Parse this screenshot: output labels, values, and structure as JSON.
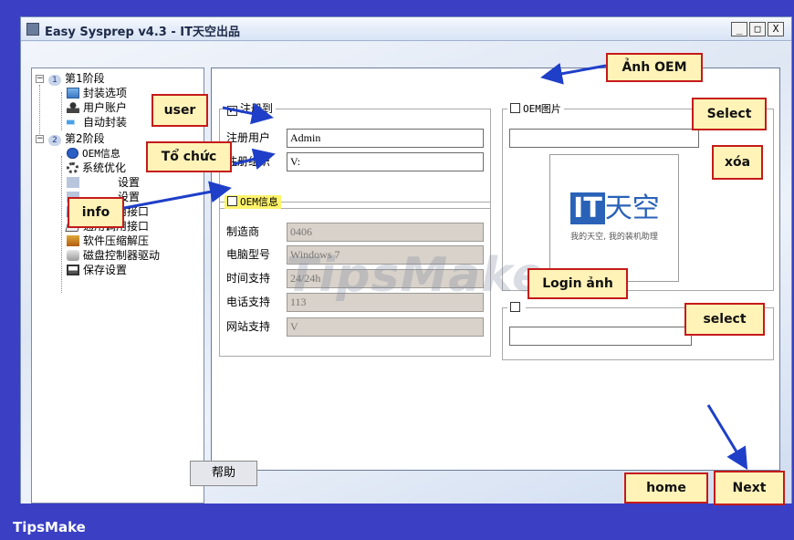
{
  "window": {
    "title": "Easy Sysprep v4.3 - IT天空出品",
    "minimize": "_",
    "maximize": "□",
    "close": "X"
  },
  "tree": {
    "stage1": {
      "num": "1",
      "label": "第1阶段",
      "expander": "−"
    },
    "stage1_items": [
      "封装选项",
      "用户账户",
      "自动封装"
    ],
    "stage2": {
      "num": "2",
      "label": "第2阶段",
      "expander": "−"
    },
    "stage2_items": [
      "OEM信息",
      "系统优化",
      "设置",
      "设置",
      "专用调用接口",
      "通用调用接口",
      "软件压缩解压",
      "磁盘控制器驱动",
      "保存设置"
    ]
  },
  "register": {
    "group_label": "注册到",
    "checked": true,
    "check_mark": "✓",
    "user_label": "注册用户",
    "user_value": "Admin",
    "org_label": "注册组织",
    "org_value": "V:"
  },
  "oem_info": {
    "group_label": "OEM信息",
    "checked": false,
    "manufacturer_label": "制造商",
    "manufacturer_value": "0406",
    "model_label": "电脑型号",
    "model_value": "Windows 7",
    "support_hours_label": "时间支持",
    "support_hours_value": "24/24h",
    "phone_label": "电话支持",
    "phone_value": "113",
    "website_label": "网站支持",
    "website_value": "V"
  },
  "oem_image": {
    "group_label": "OEM图片",
    "checked": false,
    "path_value": "",
    "logo_main": "IT天空",
    "logo_it": "IT",
    "logo_chinese": "天空",
    "logo_tagline": "我的天空, 我的装机助理"
  },
  "login_image": {
    "path_value": ""
  },
  "buttons": {
    "help": "帮助"
  },
  "callouts": {
    "oem_image": "Ảnh OEM",
    "user": "user",
    "organization": "Tổ chức",
    "info": "info",
    "select_top": "Select",
    "delete": "xóa",
    "login_image": "Login ảnh",
    "select_bottom": "select",
    "home": "home",
    "next": "Next"
  },
  "watermark": "TipsMake",
  "footer": "TipsMake",
  "colors": {
    "frame_blue": "#3a3fc4",
    "callout_border": "#c51a1a",
    "callout_fill": "#fff3b8",
    "arrow_blue": "#1f3fc8",
    "logo_blue": "#2a62b8"
  }
}
